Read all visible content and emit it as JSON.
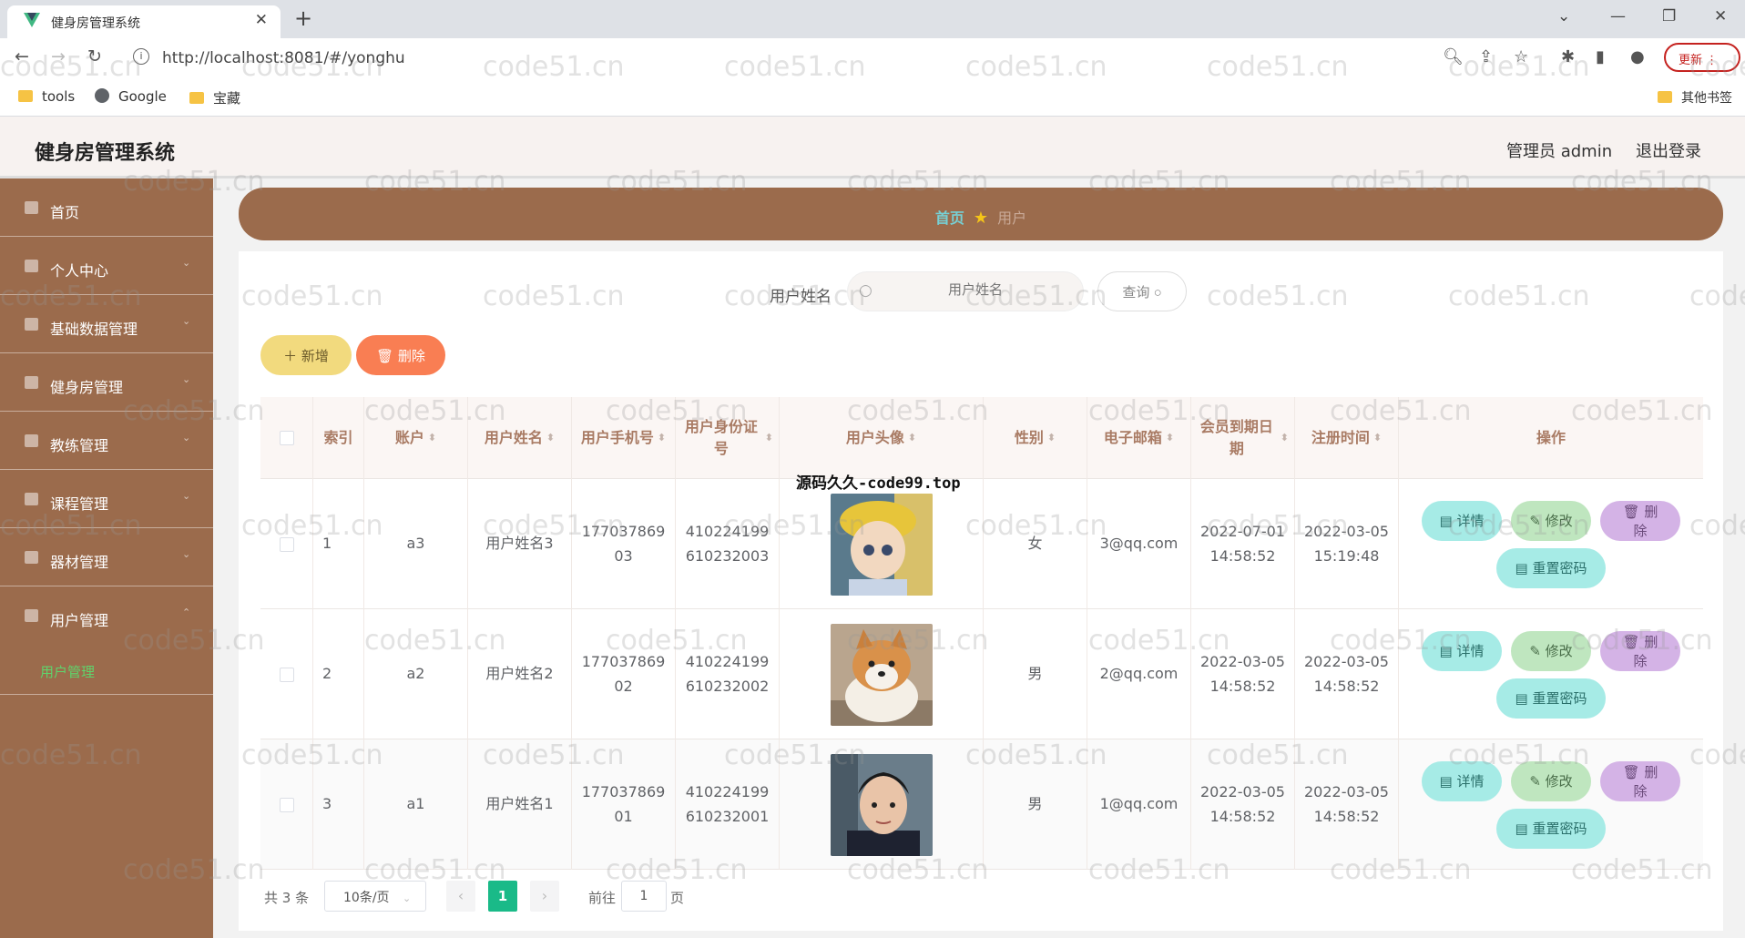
{
  "browser": {
    "tab_title": "健身房管理系统",
    "new_tab": "+",
    "url": "http://localhost:8081/#/yonghu",
    "update_label": "更新",
    "bookmarks": [
      "tools",
      "Google",
      "宝藏"
    ],
    "other_bookmarks": "其他书签"
  },
  "header": {
    "title": "健身房管理系统",
    "admin_label": "管理员 admin",
    "logout": "退出登录"
  },
  "sidebar": {
    "items": [
      {
        "label": "首页"
      },
      {
        "label": "个人中心"
      },
      {
        "label": "基础数据管理"
      },
      {
        "label": "健身房管理"
      },
      {
        "label": "教练管理"
      },
      {
        "label": "课程管理"
      },
      {
        "label": "器材管理"
      },
      {
        "label": "用户管理"
      }
    ],
    "active_sub": "用户管理"
  },
  "breadcrumb": {
    "home": "首页",
    "current": "用户"
  },
  "search": {
    "label": "用户姓名",
    "placeholder": "用户姓名",
    "query_button": "查询"
  },
  "actions": {
    "add": "新增",
    "delete": "删除"
  },
  "table": {
    "columns": [
      "索引",
      "账户",
      "用户姓名",
      "用户手机号",
      "用户身份证号",
      "用户头像",
      "性别",
      "电子邮箱",
      "会员到期日期",
      "注册时间",
      "操作"
    ],
    "rows": [
      {
        "index": "1",
        "account": "a3",
        "name": "用户姓名3",
        "phone": "17703786903",
        "idcard": "410224199610232003",
        "gender": "女",
        "email": "3@qq.com",
        "expire": "2022-07-01 14:58:52",
        "register": "2022-03-05 15:19:48"
      },
      {
        "index": "2",
        "account": "a2",
        "name": "用户姓名2",
        "phone": "17703786902",
        "idcard": "410224199610232002",
        "gender": "男",
        "email": "2@qq.com",
        "expire": "2022-03-05 14:58:52",
        "register": "2022-03-05 14:58:52"
      },
      {
        "index": "3",
        "account": "a1",
        "name": "用户姓名1",
        "phone": "17703786901",
        "idcard": "410224199610232001",
        "gender": "男",
        "email": "1@qq.com",
        "expire": "2022-03-05 14:58:52",
        "register": "2022-03-05 14:58:52"
      }
    ],
    "op_labels": {
      "detail": "详情",
      "edit": "修改",
      "delete": "删除",
      "reset": "重置密码"
    }
  },
  "pagination": {
    "total": "共 3 条",
    "page_size": "10条/页",
    "current_page": "1",
    "goto_label": "前往",
    "goto_value": "1",
    "page_unit": "页"
  },
  "overlay_text": "源码久久-code99.top",
  "watermark": "code51.cn",
  "colors": {
    "sidebar": "#9b6b4c",
    "breadcrumb_home": "#77d0d4",
    "active_page": "#1aba88",
    "active_submenu": "#5fd46c"
  }
}
